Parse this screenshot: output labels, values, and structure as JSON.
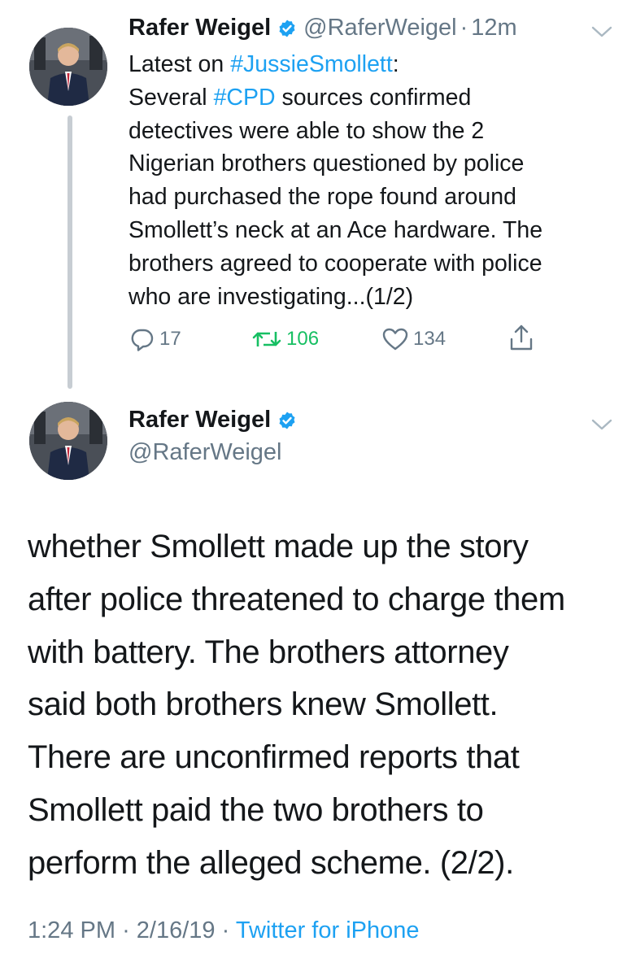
{
  "tweet1": {
    "author_name": "Rafer Weigel",
    "handle": "@RaferWeigel",
    "separator": "·",
    "time": "12m",
    "text_parts": [
      {
        "text": "Latest on ",
        "type": "plain"
      },
      {
        "text": "#JussieSmollett",
        "type": "hashtag"
      },
      {
        "text": ":\nSeveral ",
        "type": "plain"
      },
      {
        "text": "#CPD",
        "type": "hashtag"
      },
      {
        "text": " sources confirmed\ndetectives were able to show the 2\nNigerian brothers questioned by police\nhad purchased the rope found around\nSmollett’s neck at an Ace hardware. The\nbrothers agreed to cooperate with police\nwho are investigating...(1/2)",
        "type": "plain"
      }
    ],
    "actions": {
      "replies": "17",
      "retweets": "106",
      "likes": "134"
    }
  },
  "tweet2": {
    "author_name": "Rafer Weigel",
    "handle": "@RaferWeigel",
    "text": "whether Smollett made up the story\nafter police threatened to charge them\nwith battery.  The brothers attorney\nsaid both brothers knew Smollett.\nThere are unconfirmed reports that\nSmollett paid the two brothers to\nperform the alleged scheme. (2/2).",
    "timestamp_time": "1:24 PM",
    "timestamp_date": "2/16/19",
    "separator": "·",
    "source": "Twitter for iPhone"
  },
  "icons": {
    "verified": "verified-badge-icon",
    "chevron": "chevron-down-icon",
    "reply": "reply-icon",
    "retweet": "retweet-icon",
    "like": "heart-icon",
    "share": "share-icon"
  },
  "colors": {
    "accent": "#1da1f2",
    "retweet_green": "#17bf63",
    "muted": "#657786",
    "text": "#14171a",
    "thread_line": "#c7cdd3"
  }
}
